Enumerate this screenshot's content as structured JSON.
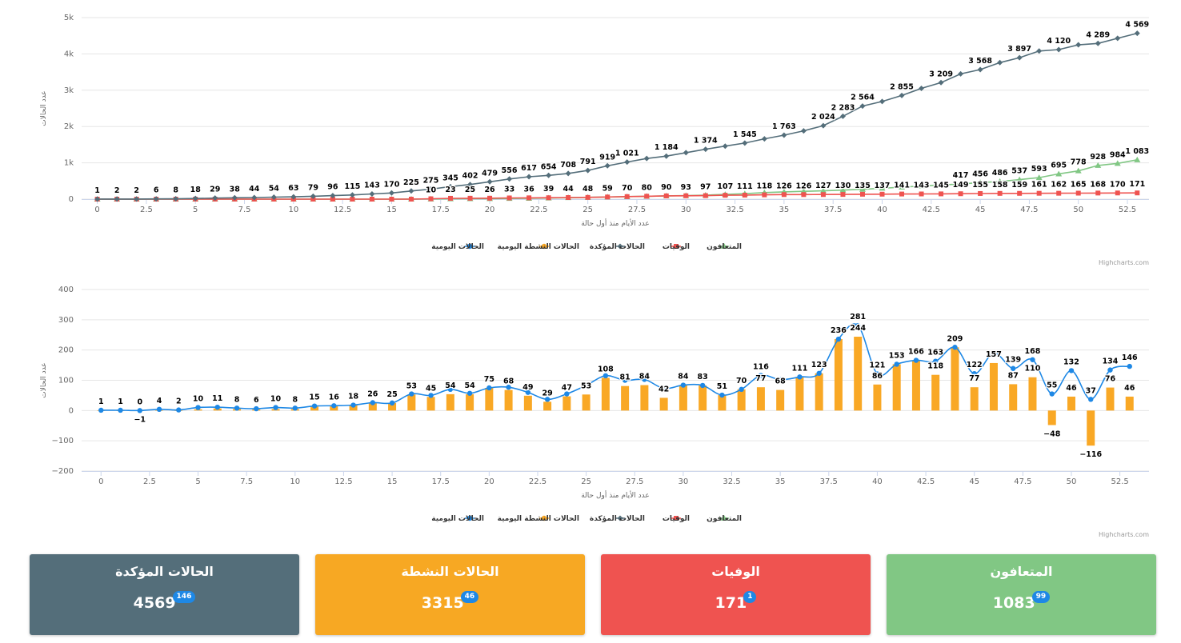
{
  "chart_data": [
    {
      "type": "line",
      "xlabel": "عدد الأيام منذ أول حالة",
      "ylabel": "عدد الحالات",
      "xlim": [
        -0.8,
        53.6
      ],
      "ylim": [
        0,
        5000
      ],
      "xticks": [
        0,
        2.5,
        5,
        7.5,
        10,
        12.5,
        15,
        17.5,
        20,
        22.5,
        25,
        27.5,
        30,
        32.5,
        35,
        37.5,
        40,
        42.5,
        45,
        47.5,
        50,
        52.5
      ],
      "yticks": [
        0,
        1000,
        2000,
        3000,
        4000,
        5000
      ],
      "ytick_labels": [
        "0",
        "1k",
        "2k",
        "3k",
        "4k",
        "5k"
      ],
      "grid": true,
      "legend": "bottom-center",
      "series": [
        {
          "name": "الحالات المؤكدة",
          "color": "#546e7a",
          "marker": "diamond",
          "values": [
            1,
            2,
            2,
            6,
            8,
            18,
            29,
            38,
            44,
            54,
            63,
            79,
            96,
            115,
            143,
            170,
            225,
            275,
            345,
            402,
            479,
            556,
            617,
            654,
            708,
            791,
            919,
            1021,
            1120,
            1184,
            1280,
            1374,
            1460,
            1545,
            1660,
            1763,
            1880,
            2024,
            2283,
            2564,
            2690,
            2855,
            3050,
            3209,
            3450,
            3568,
            3760,
            3897,
            4080,
            4120,
            4250,
            4289,
            4430,
            4569
          ],
          "labels": [
            "1",
            "2",
            "2",
            "6",
            "8",
            "18",
            "29",
            "38",
            "44",
            "54",
            "63",
            "79",
            "96",
            "115",
            "143",
            "170",
            "225",
            "275",
            "345",
            "402",
            "479",
            "556",
            "617",
            "654",
            "708",
            "791",
            "919",
            "1 021",
            "",
            "1 184",
            "",
            "1 374",
            "",
            "1 545",
            "",
            "1 763",
            "",
            "2 024",
            "2 283",
            "2 564",
            "",
            "2 855",
            "",
            "3 209",
            "",
            "3 568",
            "",
            "3 897",
            "",
            "4 120",
            "",
            "4 289",
            "",
            "4 569"
          ]
        },
        {
          "name": "الوفيات",
          "color": "#ef5350",
          "marker": "square",
          "values": [
            0,
            0,
            0,
            0,
            0,
            0,
            0,
            0,
            0,
            0,
            0,
            0,
            0,
            0,
            0,
            0,
            0,
            10,
            23,
            25,
            26,
            33,
            36,
            39,
            44,
            48,
            59,
            70,
            80,
            90,
            93,
            97,
            107,
            111,
            118,
            126,
            126,
            127,
            130,
            135,
            137,
            141,
            143,
            145,
            149,
            155,
            158,
            159,
            161,
            162,
            165,
            168,
            170,
            171
          ],
          "labels": [
            "",
            "",
            "",
            "",
            "",
            "",
            "",
            "",
            "",
            "",
            "",
            "",
            "",
            "",
            "",
            "",
            "",
            "10",
            "23",
            "25",
            "26",
            "33",
            "36",
            "39",
            "44",
            "48",
            "59",
            "70",
            "80",
            "90",
            "93",
            "97",
            "107",
            "111",
            "118",
            "126",
            "126",
            "127",
            "130",
            "135",
            "137",
            "141",
            "143",
            "145",
            "149",
            "155",
            "158",
            "159",
            "161",
            "162",
            "165",
            "168",
            "170",
            "171"
          ]
        },
        {
          "name": "المتعافون",
          "color": "#81c784",
          "marker": "triangle",
          "values": [
            0,
            0,
            0,
            0,
            0,
            0,
            0,
            0,
            0,
            0,
            0,
            0,
            0,
            0,
            0,
            0,
            2,
            4,
            8,
            10,
            14,
            18,
            22,
            30,
            40,
            50,
            60,
            70,
            80,
            90,
            100,
            110,
            130,
            150,
            180,
            200,
            215,
            230,
            250,
            270,
            300,
            330,
            360,
            390,
            417,
            456,
            486,
            537,
            593,
            695,
            778,
            928,
            984,
            1083
          ],
          "labels": [
            "",
            "",
            "",
            "",
            "",
            "",
            "",
            "",
            "",
            "",
            "",
            "",
            "",
            "",
            "",
            "",
            "",
            "",
            "",
            "",
            "",
            "",
            "",
            "",
            "",
            "",
            "",
            "",
            "",
            "",
            "",
            "",
            "",
            "",
            "",
            "",
            "",
            "",
            "",
            "",
            "",
            "",
            "",
            "",
            "417",
            "456",
            "486",
            "537",
            "593",
            "695",
            "778",
            "928",
            "984",
            "1 083"
          ]
        }
      ]
    },
    {
      "type": "bar",
      "xlabel": "عدد الأيام منذ أول حالة",
      "ylabel": "عدد الحالات",
      "xlim": [
        -1,
        54
      ],
      "ylim": [
        -200,
        400
      ],
      "xticks": [
        0,
        2.5,
        5,
        7.5,
        10,
        12.5,
        15,
        17.5,
        20,
        22.5,
        25,
        27.5,
        30,
        32.5,
        35,
        37.5,
        40,
        42.5,
        45,
        47.5,
        50,
        52.5
      ],
      "yticks": [
        -200,
        -100,
        0,
        100,
        200,
        300,
        400
      ],
      "ytick_labels": [
        "−200",
        "−100",
        "0",
        "100",
        "200",
        "300",
        "400"
      ],
      "grid": true,
      "legend": "bottom-center",
      "series": [
        {
          "name": "الحالات اليومية",
          "type": "line",
          "color": "#1e88e5",
          "values": [
            1,
            1,
            0,
            4,
            2,
            10,
            11,
            8,
            6,
            10,
            8,
            15,
            16,
            18,
            26,
            25,
            55,
            50,
            70,
            57,
            75,
            77,
            60,
            37,
            55,
            83,
            115,
            100,
            103,
            73,
            84,
            83,
            51,
            70,
            116,
            102,
            111,
            123,
            236,
            281,
            121,
            153,
            166,
            163,
            209,
            122,
            190,
            139,
            168,
            55,
            132,
            37,
            134,
            146
          ],
          "labels": [
            "1",
            "1",
            "0",
            "4",
            "2",
            "10",
            "11",
            "8",
            "6",
            "10",
            "8",
            "15",
            "16",
            "18",
            "26",
            "25",
            "",
            "",
            "",
            "",
            "",
            "",
            "",
            "",
            "",
            "",
            "",
            "",
            "",
            "",
            "",
            "",
            "",
            "",
            "116",
            "",
            "",
            "",
            "",
            "281",
            "121",
            "",
            "",
            "163",
            "",
            "122",
            "",
            "139",
            "168",
            "55",
            "132",
            "37",
            "134",
            "146"
          ]
        },
        {
          "name": "الحالات النشطة اليومية",
          "type": "bar",
          "color": "#f9a825",
          "values": [
            0,
            0,
            -1,
            0,
            0,
            4,
            7,
            5,
            4,
            5,
            5,
            13,
            15,
            18,
            26,
            25,
            53,
            45,
            54,
            54,
            75,
            68,
            49,
            29,
            47,
            53,
            108,
            81,
            84,
            42,
            84,
            83,
            51,
            70,
            77,
            68,
            111,
            123,
            236,
            244,
            86,
            153,
            166,
            118,
            209,
            77,
            157,
            87,
            110,
            -48,
            46,
            -116,
            76,
            46
          ],
          "labels": [
            "",
            "",
            "−1",
            "",
            "",
            "",
            "",
            "",
            "",
            "",
            "",
            "",
            "",
            "",
            "",
            "",
            "53",
            "45",
            "54",
            "54",
            "75",
            "68",
            "49",
            "29",
            "47",
            "53",
            "108",
            "81",
            "84",
            "42",
            "84",
            "83",
            "51",
            "70",
            "77",
            "68",
            "111",
            "123",
            "236",
            "244",
            "86",
            "153",
            "166",
            "118",
            "209",
            "77",
            "157",
            "87",
            "110",
            "−48",
            "46",
            "−116",
            "76",
            "46"
          ]
        }
      ]
    }
  ],
  "legend": {
    "items": [
      {
        "label": "الحالات اليومية",
        "color": "#1e88e5",
        "marker": "circle"
      },
      {
        "label": "الحالات النشطة اليومية",
        "color": "#f9a825",
        "marker": "circle"
      },
      {
        "label": "الحالات المؤكدة",
        "color": "#546e7a",
        "marker": "diamond"
      },
      {
        "label": "الوفيات",
        "color": "#ef5350",
        "marker": "square"
      },
      {
        "label": "المتعافون",
        "color": "#81c784",
        "marker": "triangle"
      }
    ]
  },
  "credits": "Highcharts.com",
  "cards": [
    {
      "title": "الحالات المؤكدة",
      "value": "4569",
      "badge": "146",
      "color": "#546e7a"
    },
    {
      "title": "الحالات النشطة",
      "value": "3315",
      "badge": "46",
      "color": "#f7a823"
    },
    {
      "title": "الوفيات",
      "value": "171",
      "badge": "1",
      "color": "#ef5350"
    },
    {
      "title": "المتعافون",
      "value": "1083",
      "badge": "99",
      "color": "#81c784"
    }
  ]
}
